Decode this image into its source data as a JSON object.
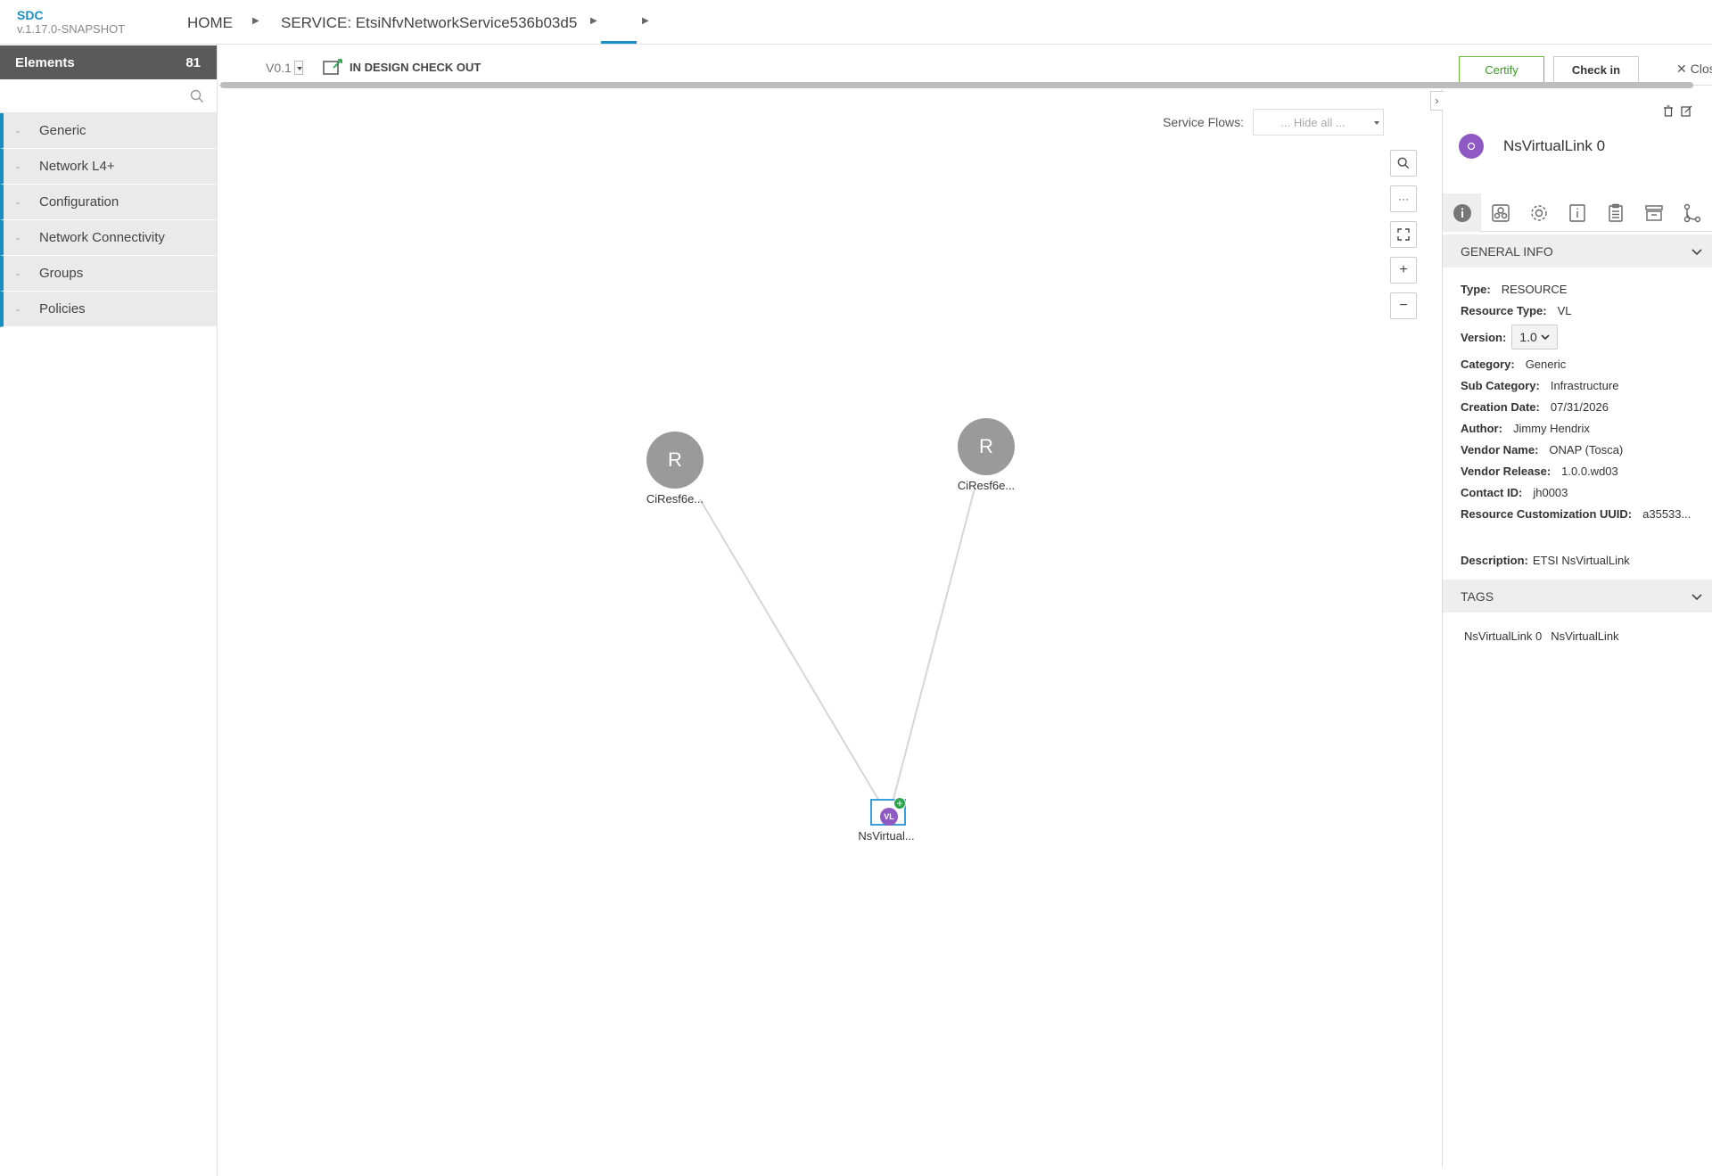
{
  "app": {
    "name": "SDC",
    "version": "v.1.17.0-SNAPSHOT"
  },
  "breadcrumb": {
    "home": "HOME",
    "service": "SERVICE: EtsiNfvNetworkService536b03d5"
  },
  "palette": {
    "title": "Elements",
    "count": "81",
    "search_placeholder": "",
    "categories": [
      {
        "label": "Generic"
      },
      {
        "label": "Network L4+"
      },
      {
        "label": "Configuration"
      },
      {
        "label": "Network Connectivity"
      },
      {
        "label": "Groups"
      },
      {
        "label": "Policies"
      }
    ]
  },
  "toolbar": {
    "version": "V0.1",
    "status": "IN DESIGN CHECK OUT",
    "certify_label": "Certify",
    "checkin_label": "Check in",
    "close_label": "Close"
  },
  "canvas": {
    "service_flows_label": "Service Flows:",
    "service_flows_value": "... Hide all ...",
    "nodes": [
      {
        "letter": "R",
        "label": "CiResf6e..."
      },
      {
        "letter": "R",
        "label": "CiResf6e..."
      },
      {
        "badge": "VL",
        "label": "NsVirtual..."
      }
    ]
  },
  "details": {
    "title": "NsVirtualLink 0",
    "general_info_title": "GENERAL INFO",
    "type_label": "Type:",
    "type_value": "RESOURCE",
    "resource_type_label": "Resource Type:",
    "resource_type_value": "VL",
    "version_label": "Version:",
    "version_value": "1.0",
    "category_label": "Category:",
    "category_value": "Generic",
    "subcategory_label": "Sub Category:",
    "subcategory_value": "Infrastructure",
    "creation_date_label": "Creation Date:",
    "creation_date_value": "07/31/2026",
    "author_label": "Author:",
    "author_value": "Jimmy Hendrix",
    "vendor_name_label": "Vendor Name:",
    "vendor_name_value": "ONAP (Tosca)",
    "vendor_release_label": "Vendor Release:",
    "vendor_release_value": "1.0.0.wd03",
    "contact_id_label": "Contact ID:",
    "contact_id_value": "jh0003",
    "uuid_label": "Resource Customization UUID:",
    "uuid_value": "a35533...",
    "description_label": "Description:",
    "description_value": "ETSI NsVirtualLink",
    "tags_title": "TAGS",
    "tags": [
      "NsVirtualLink 0",
      "NsVirtualLink"
    ]
  },
  "colors": {
    "accent": "#1a8fc3",
    "certify": "#3a9d23",
    "vl_badge": "#8e59c4",
    "add_badge": "#2da44e"
  }
}
